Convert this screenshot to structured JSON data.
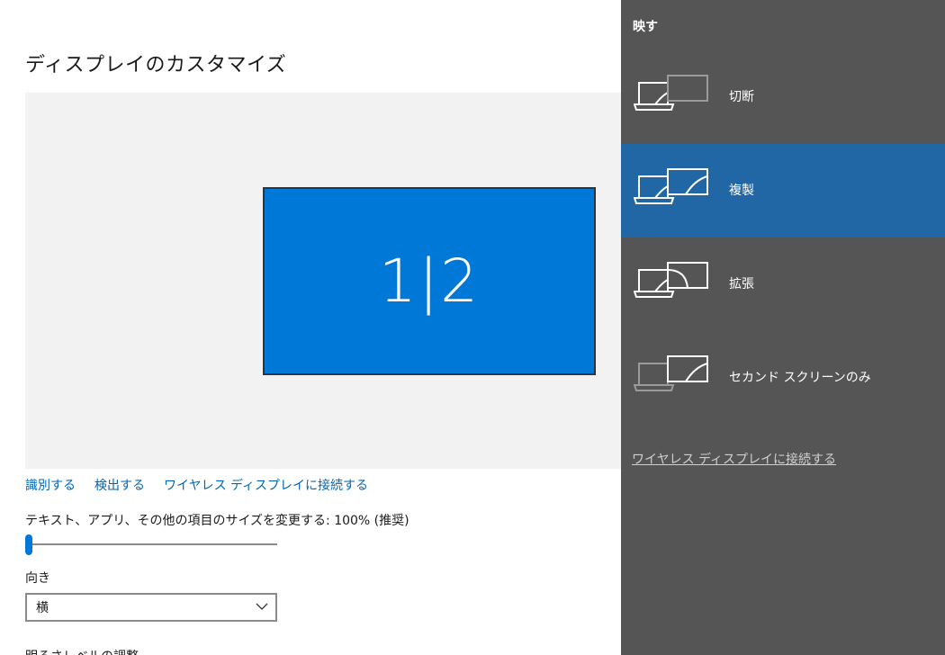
{
  "page": {
    "title": "ディスプレイのカスタマイズ",
    "monitor_label": "1|2",
    "links": {
      "identify": "識別する",
      "detect": "検出する",
      "wireless": "ワイヤレス ディスプレイに接続する"
    },
    "scale_label": "テキスト、アプリ、その他の項目のサイズを変更する: 100% (推奨)",
    "scale_slider_value": 0,
    "orientation_label": "向き",
    "orientation_value": "横",
    "brightness_label": "明るさレベルの調整"
  },
  "flyout": {
    "title": "映す",
    "options": [
      {
        "label": "切断",
        "icon": "pc-screen-only-icon",
        "selected": false
      },
      {
        "label": "複製",
        "icon": "duplicate-icon",
        "selected": true
      },
      {
        "label": "拡張",
        "icon": "extend-icon",
        "selected": false
      },
      {
        "label": "セカンド スクリーンのみ",
        "icon": "second-screen-only-icon",
        "selected": false
      }
    ],
    "wireless_link": "ワイヤレス ディスプレイに接続する"
  },
  "colors": {
    "accent": "#0078d7",
    "link": "#0066b4",
    "flyout_bg": "#555555",
    "flyout_selected": "#2167a5"
  }
}
